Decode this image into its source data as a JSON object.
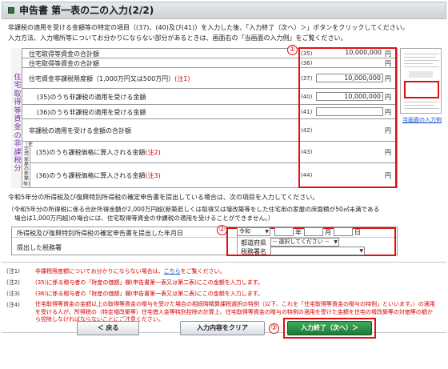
{
  "header": {
    "title": "申告書 第一表の二の入力(2/2)"
  },
  "intro": {
    "line1": "非課税の適用を受ける金額等の特定の項目（(37)、(40)及び(41)）を入力した後、「入力終了（次へ）＞」ボタンをクリックしてください。",
    "line2": "入力方法、入力場所等についてお分かりにならない部分があるときは、画面右の「当画面の入力例」をご覧ください。"
  },
  "table": {
    "vertical_title": "住宅取得等資金の非課税分",
    "vertical_sub": "（住宅用家屋の新築等）",
    "rows": [
      {
        "label": "住宅取得等資金の合計額",
        "note": "",
        "num": "(35)",
        "value": "10,000,000",
        "unit": "円"
      },
      {
        "label": "住宅取得等資金の合計額",
        "note": "",
        "num": "(36)",
        "value": "",
        "unit": "円"
      },
      {
        "label": "住宅資金非課税限度額（1,000万円又は500万円）",
        "note": "(注1)",
        "num": "(37)",
        "value": "10,000,000",
        "unit": "円"
      },
      {
        "label": "(35)のうち非課税の適用を受ける金額",
        "note": "",
        "num": "(40)",
        "value": "10,000,000",
        "unit": "円"
      },
      {
        "label": "(36)のうち非課税の適用を受ける金額",
        "note": "",
        "num": "(41)",
        "value": "",
        "unit": "円"
      },
      {
        "label": "非課税の適用を受ける金額の合計額",
        "note": "",
        "num": "(42)",
        "value": "",
        "unit": "円"
      },
      {
        "label": "(35)のうち課税価格に算入される金額",
        "note": "(注2)",
        "num": "(43)",
        "value": "",
        "unit": "円"
      },
      {
        "label": "(36)のうち課税価格に算入される金額",
        "note": "(注3)",
        "num": "(44)",
        "value": "",
        "unit": "円"
      }
    ]
  },
  "callouts": {
    "one": "①",
    "two": "②",
    "three": "③"
  },
  "sample": {
    "link": "当画面の入力例"
  },
  "section2": {
    "line1": "令和5年分の所得税及び復興特別所得税の確定申告書を提出している場合は、次の項目を入力してください。",
    "line2": "（令和5年分の所得税に係る合計所得金額が2,000万円超(新築若しくは取得又は増改築等をした住宅用の家屋の床面積が50㎡未満である",
    "line3": "場合は1,000万円超)の場合には、住宅取得等資金の非課税の適用を受けることができません。）"
  },
  "form2": {
    "date_label": "所得税及び復興特別所得税の確定申告書を提出した年月日",
    "era": "令和",
    "year_unit": "年",
    "month_unit": "月",
    "day_unit": "日",
    "office_label": "提出した税務署",
    "pref_label": "都道府県",
    "pref_value": "-- 選択してください --",
    "office_sel_label": "税務署名",
    "office_value": ""
  },
  "notes": {
    "n1_key": "(注1)",
    "n1_text": "非課税限度額についてお分かりにならない場合は、",
    "n1_link": "こちら",
    "n1_tail": "をご覧ください。",
    "n2_key": "(注2)",
    "n2_text": "(35)に係る贈与者の「財産の価額」欄(申告書第一表又は第二表)にこの金額を入力します。",
    "n3_key": "(注3)",
    "n3_text": "(36)に係る贈与者の「財産の価額」欄(申告書第一表又は第二表)にこの金額を入力します。",
    "n4_key": "(注4)",
    "n4_text": "住宅取得等資金の金額以上の取得等資金の贈与を受けた場合の相続時精算課税選択の特例（以下、これを「住宅取得等資金の贈与の特例」といいます。）の適用を受ける人が、所得税の（特定増改築等）住宅借入金等特別控除の計算上、住宅取得等資金の贈与の特例の適用を受けた金額を住宅の増改築等の対価等の額から控除しなければならないことにご注意ください。"
  },
  "buttons": {
    "back": "＜ 戻る",
    "clear": "入力内容をクリア",
    "next": "入力終了（次へ）＞"
  }
}
